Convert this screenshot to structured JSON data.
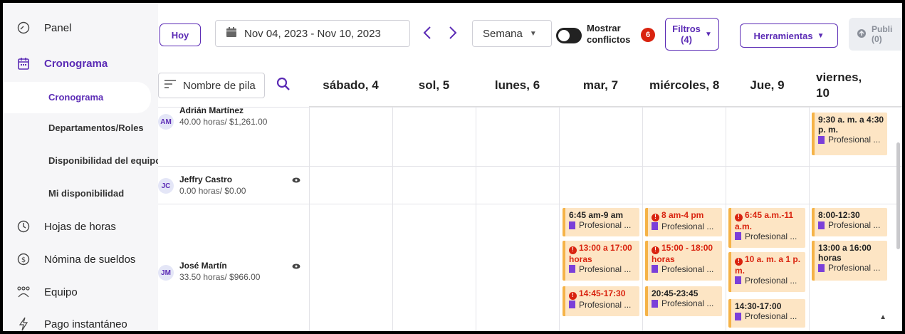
{
  "sidebar": {
    "items": [
      {
        "label": "Panel",
        "icon": "dashboard-icon"
      },
      {
        "label": "Cronograma",
        "icon": "calendar-icon"
      },
      {
        "label": "Hojas de horas",
        "icon": "clock-icon"
      },
      {
        "label": "Nómina de sueldos",
        "icon": "dollar-icon"
      },
      {
        "label": "Equipo",
        "icon": "team-icon"
      },
      {
        "label": "Pago instantáneo",
        "icon": "lightning-icon"
      }
    ],
    "sub_items": [
      "Cronograma",
      "Departamentos/Roles",
      "Disponibilidad del equipo",
      "Mi disponibilidad"
    ]
  },
  "toolbar": {
    "today": "Hoy",
    "date_range": "Nov 04, 2023 - Nov 10, 2023",
    "prev": "‹",
    "next": "›",
    "view": "Semana",
    "toggle_label": "Mostrar conflictos",
    "conflict_count": "6",
    "filters": "Filtros (4)",
    "tools": "Herramientas",
    "publish": "Publi (0)"
  },
  "grid": {
    "name_filter": "Nombre de pila",
    "days": [
      "sábado, 4",
      "sol, 5",
      "lunes, 6",
      "mar, 7",
      "miércoles, 8",
      "Jue, 9",
      "viernes, 10"
    ]
  },
  "employees": [
    {
      "initials": "AM",
      "name": "Adrián Martínez",
      "hours": "40.00 horas/ $1,261.00"
    },
    {
      "initials": "JC",
      "name": "Jeffry Castro",
      "hours": "0.00 horas/ $0.00"
    },
    {
      "initials": "JM",
      "name": "José Martín",
      "hours": "33.50 horas/ $966.00"
    }
  ],
  "shifts": {
    "am_fri": {
      "time": "9:30 a. m. a 4:30 p. m.",
      "role": "Profesional ..."
    },
    "jm_tue_1": {
      "time": "6:45 am-9 am",
      "role": "Profesional ..."
    },
    "jm_tue_2": {
      "time": "13:00 a 17:00 horas",
      "role": "Profesional ..."
    },
    "jm_tue_3": {
      "time": "14:45-17:30",
      "role": "Profesional ..."
    },
    "jm_wed_1": {
      "time": "8 am-4 pm",
      "role": "Profesional ..."
    },
    "jm_wed_2": {
      "time": "15:00 - 18:00 horas",
      "role": "Profesional ..."
    },
    "jm_wed_3": {
      "time": "20:45-23:45",
      "role": "Profesional ..."
    },
    "jm_thu_1": {
      "time": "6:45 a.m.-11 a.m.",
      "role": "Profesional ..."
    },
    "jm_thu_2": {
      "time": "10 a. m. a 1 p. m.",
      "role": "Profesional ..."
    },
    "jm_thu_3": {
      "time": "14:30-17:00",
      "role": "Profesional ..."
    },
    "jm_fri_1": {
      "time": "8:00-12:30",
      "role": "Profesional ..."
    },
    "jm_fri_2": {
      "time": "13:00 a 16:00 horas",
      "role": "Profesional ..."
    }
  },
  "colors": {
    "accent": "#5b2bb5",
    "conflict": "#d9230f",
    "shift_bg": "#fde5c4",
    "shift_border": "#f5b347"
  }
}
